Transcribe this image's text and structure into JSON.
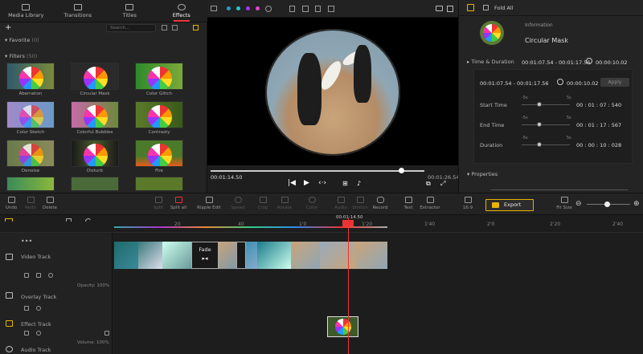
{
  "library": {
    "tabs": [
      {
        "label": "Media Library",
        "icon": "media-library-icon"
      },
      {
        "label": "Transitions",
        "icon": "transitions-icon"
      },
      {
        "label": "Titles",
        "icon": "titles-icon"
      },
      {
        "label": "Effects",
        "icon": "effects-icon",
        "active": true
      }
    ],
    "search_placeholder": "Search...",
    "favorite_label": "Favorite",
    "favorite_count": "(0)",
    "filters_label": "Filters",
    "filters_count": "(50)",
    "items": [
      {
        "label": "Aberration"
      },
      {
        "label": "Circular Mask"
      },
      {
        "label": "Color Glitch"
      },
      {
        "label": "Color Sketch"
      },
      {
        "label": "Colorful Bubbles"
      },
      {
        "label": "Contrasty"
      },
      {
        "label": "Denoise"
      },
      {
        "label": "Disturb"
      },
      {
        "label": "Fire"
      }
    ]
  },
  "preview": {
    "current_time": "00:01:14.50",
    "total_time": "00:01:26.54",
    "progress": 0.89
  },
  "info": {
    "fold_all": "Fold All",
    "information_label": "Information",
    "effect_name": "Circular Mask",
    "time_duration_label": "Time & Duration",
    "time_range": "00:01:07.54 - 00:01:17.56",
    "duration_header": "00:00:10.02",
    "box_range": "00:01:07.54 - 00:01:17.56",
    "box_duration": "00:00:10.02",
    "apply_label": "Apply",
    "start_time_label": "Start Time",
    "start_time_value": "00 : 01 : 07 : 540",
    "end_time_label": "End Time",
    "end_time_value": "00 : 01 : 17 : 567",
    "duration_label": "Duration",
    "duration_value": "00 : 00 : 10 : 028",
    "slider_min": "-5s",
    "slider_max": "5s",
    "properties_label": "Properties"
  },
  "toolbar": {
    "undo": "Undo",
    "redo": "Redo",
    "delete": "Delete",
    "split": "Split",
    "split_all": "Split all",
    "ripple_edit": "Ripple Edit",
    "speed": "Speed",
    "crop": "Crop",
    "rotate": "Rotate",
    "color": "Color",
    "audio": "Audio",
    "stretch": "Stretch",
    "record": "Record",
    "text": "Text",
    "extractor": "Extractor",
    "ratio": "16:9",
    "export": "Export",
    "fit_size": "Fit Size"
  },
  "timeline": {
    "playhead_time": "00:01:14.50",
    "ruler": [
      "20",
      "40",
      "1'0",
      "1'20",
      "1'40",
      "2'0",
      "2'20",
      "2'40"
    ],
    "tracks": [
      {
        "label": "Video Track",
        "icon": "video-track-icon",
        "opacity": "Opacity: 100%"
      },
      {
        "label": "Overlay Track",
        "icon": "overlay-track-icon"
      },
      {
        "label": "Effect Track",
        "icon": "effect-track-icon"
      },
      {
        "label": "Audio Track",
        "icon": "audio-track-icon",
        "volume": "Volume: 100%"
      }
    ],
    "transition_label": "Fade"
  },
  "colors": {
    "accent": "#e8b400",
    "playhead": "#e33333",
    "active_tab": "#e83a3a"
  }
}
